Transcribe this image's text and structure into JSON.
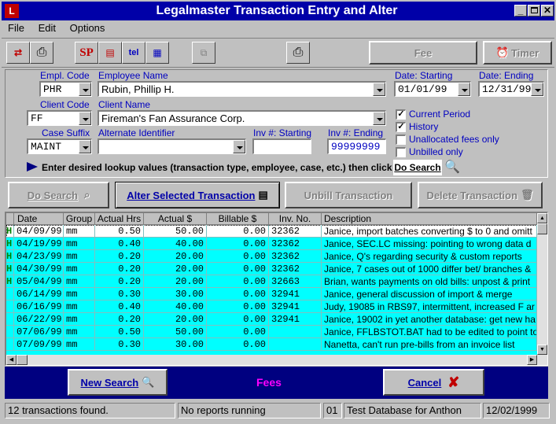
{
  "window": {
    "title": "Legalmaster Transaction Entry and Alter"
  },
  "menu": [
    "File",
    "Edit",
    "Options"
  ],
  "toolbar": {
    "fee": "Fee",
    "timer": "Timer"
  },
  "filters": {
    "empl_code_label": "Empl. Code",
    "empl_code": "PHR",
    "employee_name_label": "Employee Name",
    "employee_name": "Rubin, Phillip H.",
    "date_start_label": "Date: Starting",
    "date_start": "01/01/99",
    "date_end_label": "Date: Ending",
    "date_end": "12/31/99",
    "client_code_label": "Client Code",
    "client_code": "FF",
    "client_name_label": "Client Name",
    "client_name": "Fireman's Fan Assurance Corp.",
    "case_suffix_label": "Case Suffix",
    "case_suffix": "MAINT",
    "alt_id_label": "Alternate Identifier",
    "alt_id": "",
    "inv_start_label": "Inv #: Starting",
    "inv_start": "",
    "inv_end_label": "Inv #: Ending",
    "inv_end": "99999999"
  },
  "checks": [
    {
      "label": "Current Period",
      "checked": true
    },
    {
      "label": "History",
      "checked": true
    },
    {
      "label": "Unallocated fees only",
      "checked": false
    },
    {
      "label": "Unbilled only",
      "checked": false
    }
  ],
  "hint": "Enter desired lookup values (transaction type, employee, case, etc.) then click",
  "do_search_inline": "Do Search",
  "actions": {
    "do_search": "Do Search",
    "alter": "Alter Selected Transaction",
    "unbill": "Unbill Transaction",
    "delete": "Delete Transaction"
  },
  "columns": [
    "Date",
    "Group",
    "Actual Hrs",
    "Actual $",
    "Billable $",
    "Inv. No.",
    "Description"
  ],
  "rows": [
    {
      "mark": "H",
      "date": "04/09/99",
      "group": "mm",
      "hrs": "0.50",
      "actual": "50.00",
      "billable": "0.00",
      "inv": "32362",
      "desc": "Janice, import batches converting $ to 0 and omitt"
    },
    {
      "mark": "H",
      "date": "04/19/99",
      "group": "mm",
      "hrs": "0.40",
      "actual": "40.00",
      "billable": "0.00",
      "inv": "32362",
      "desc": "Janice, SEC.LC missing: pointing to wrong data d"
    },
    {
      "mark": "H",
      "date": "04/23/99",
      "group": "mm",
      "hrs": "0.20",
      "actual": "20.00",
      "billable": "0.00",
      "inv": "32362",
      "desc": "Janice, Q's regarding security & custom reports"
    },
    {
      "mark": "H",
      "date": "04/30/99",
      "group": "mm",
      "hrs": "0.20",
      "actual": "20.00",
      "billable": "0.00",
      "inv": "32362",
      "desc": "Janice, 7 cases out of 1000 differ bet/ branches &"
    },
    {
      "mark": "H",
      "date": "05/04/99",
      "group": "mm",
      "hrs": "0.20",
      "actual": "20.00",
      "billable": "0.00",
      "inv": "32663",
      "desc": "Brian, wants payments on old bills: unpost & print"
    },
    {
      "mark": "",
      "date": "06/14/99",
      "group": "mm",
      "hrs": "0.30",
      "actual": "30.00",
      "billable": "0.00",
      "inv": "32941",
      "desc": "Janice, general discussion of import & merge"
    },
    {
      "mark": "",
      "date": "06/16/99",
      "group": "mm",
      "hrs": "0.40",
      "actual": "40.00",
      "billable": "0.00",
      "inv": "32941",
      "desc": "Judy, 19085 in RBS97, intermittent, increased F ar"
    },
    {
      "mark": "",
      "date": "06/22/99",
      "group": "mm",
      "hrs": "0.20",
      "actual": "20.00",
      "billable": "0.00",
      "inv": "32941",
      "desc": "Janice, 19002 in yet another database: get new ha"
    },
    {
      "mark": "",
      "date": "07/06/99",
      "group": "mm",
      "hrs": "0.50",
      "actual": "50.00",
      "billable": "0.00",
      "inv": "",
      "desc": "Janice, FFLBSTOT.BAT had to be edited to point to"
    },
    {
      "mark": "",
      "date": "07/09/99",
      "group": "mm",
      "hrs": "0.30",
      "actual": "30.00",
      "billable": "0.00",
      "inv": "",
      "desc": "Nanetta, can't run pre-bills from an invoice list"
    }
  ],
  "bottom": {
    "new_search": "New Search",
    "fees": "Fees",
    "cancel": "Cancel"
  },
  "status": {
    "found": "12 transactions found.",
    "reports": "No reports running",
    "code": "01",
    "db": "Test Database for Anthon",
    "date": "12/02/1999"
  },
  "colors": {
    "title_bg": "#0000a8",
    "row_bg": "#00ffff",
    "selected_row_bg": "#ffffff",
    "bottom_bar": "#000080",
    "fees_text": "#ff00ff"
  }
}
